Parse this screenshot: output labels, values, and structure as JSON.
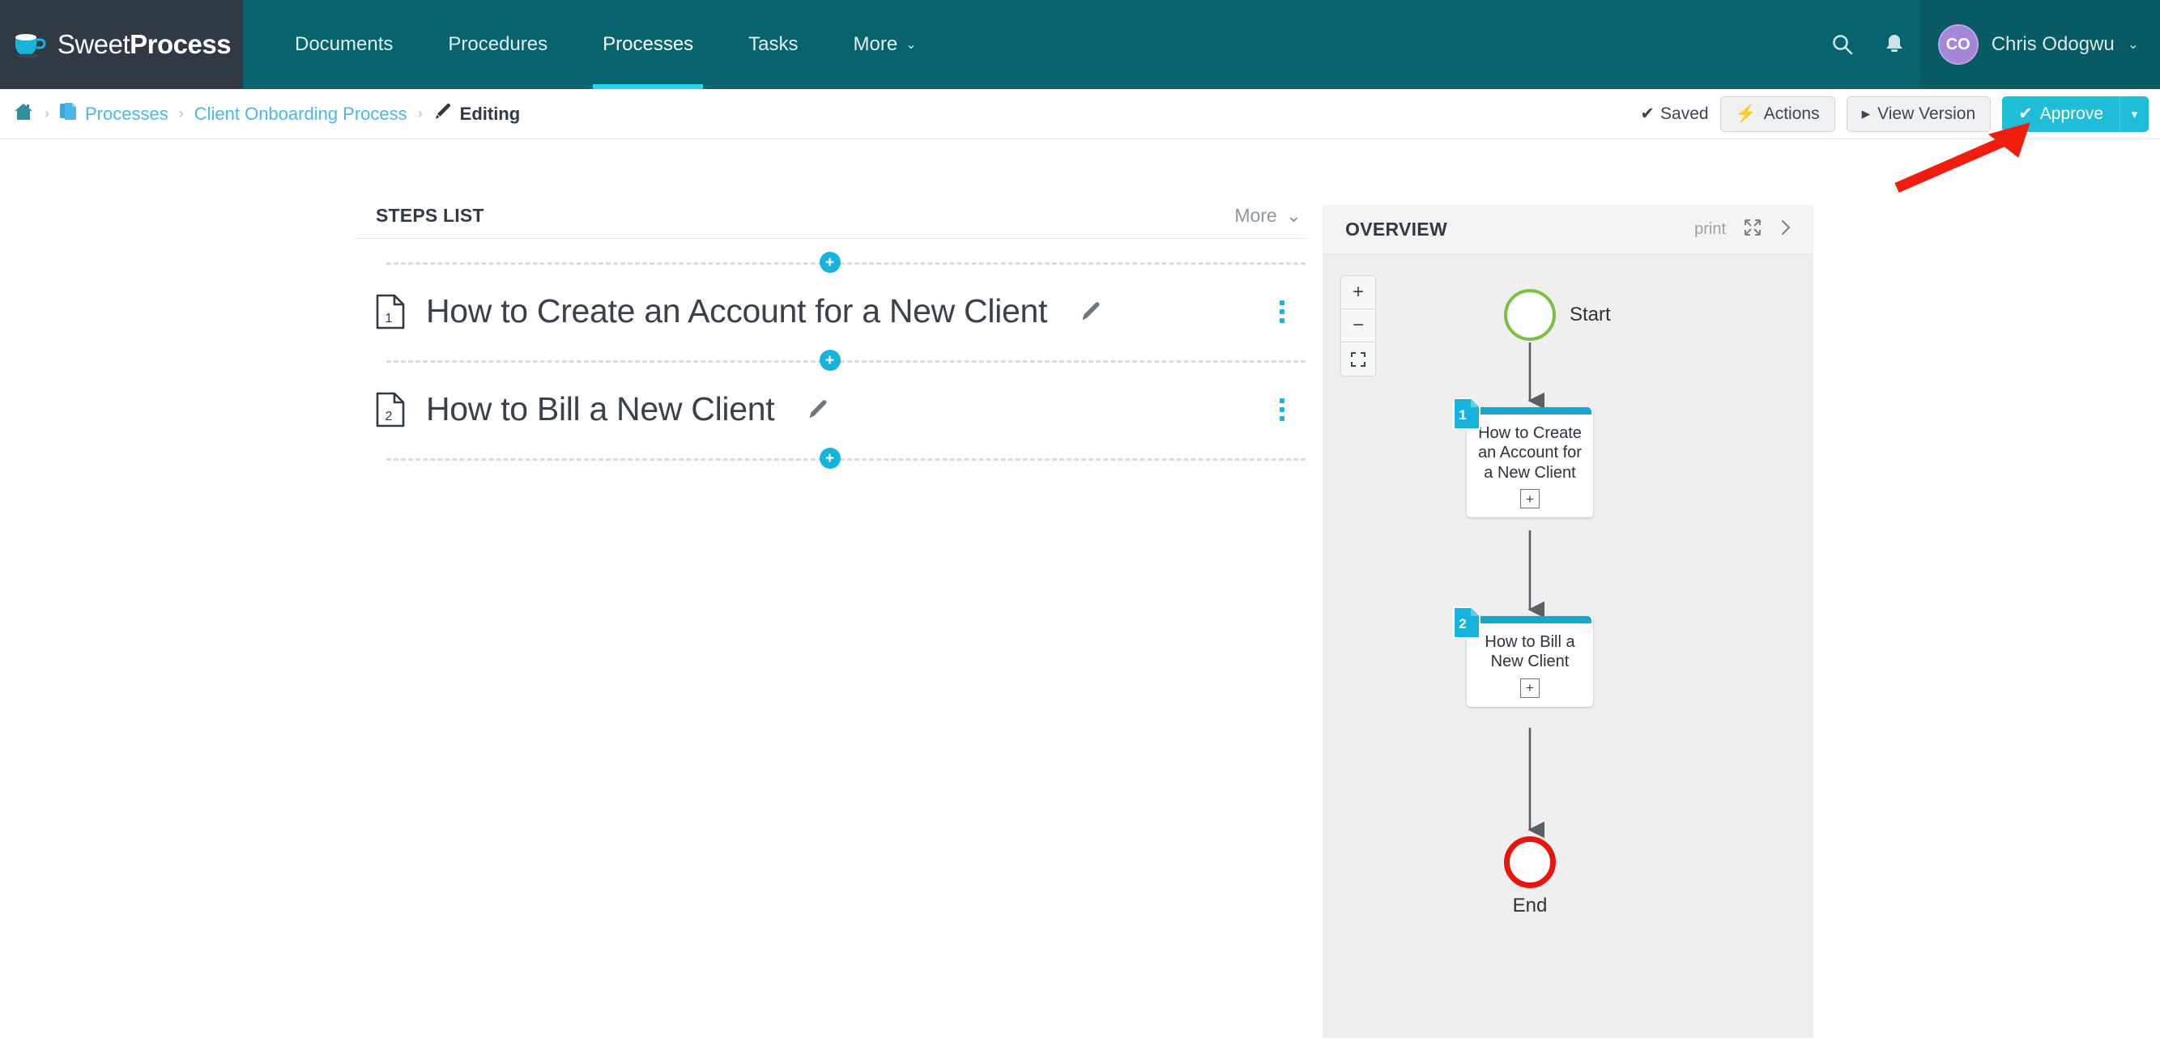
{
  "brand": {
    "name_thin": "Sweet",
    "name_bold": "Process",
    "logo_icon": "coffee-cup-icon",
    "accent_cyan": "#1fbdd8",
    "header_teal": "#07646e",
    "logo_bg": "#2f3a44"
  },
  "topnav": {
    "items": [
      {
        "label": "Documents",
        "active": false
      },
      {
        "label": "Procedures",
        "active": false
      },
      {
        "label": "Processes",
        "active": true
      },
      {
        "label": "Tasks",
        "active": false
      },
      {
        "label": "More",
        "active": false,
        "caret": "⌄"
      }
    ],
    "search_icon": "search-icon",
    "bell_icon": "bell-icon",
    "user": {
      "initials": "CO",
      "name": "Chris Odogwu",
      "caret": "⌄",
      "avatar_color": "#a586d8"
    }
  },
  "breadcrumb": {
    "home_icon": "home-icon",
    "separator": "›",
    "items": [
      {
        "label": "Processes",
        "icon": "documents-stack-icon",
        "type": "link"
      },
      {
        "label": "Client Onboarding Process",
        "icon": "",
        "type": "link"
      },
      {
        "label": "Editing",
        "icon": "pencil-icon",
        "type": "current"
      }
    ],
    "saved_label": "Saved",
    "saved_check": "✔",
    "actions": [
      {
        "label": "Actions",
        "icon": "⚡",
        "style": "default"
      },
      {
        "label": "View Version",
        "icon": "▸",
        "style": "default"
      }
    ],
    "approve": {
      "label": "Approve",
      "icon": "✔",
      "caret": "▾",
      "color": "#1fbdd8"
    }
  },
  "steps_panel": {
    "title": "STEPS LIST",
    "more_label": "More",
    "more_caret": "⌄",
    "add_step_glyph": "+",
    "steps": [
      {
        "number": "1",
        "title": "How to Create an Account for a New Client",
        "edit_icon": "pencil-icon",
        "menu_icon": "kebab-menu-icon"
      },
      {
        "number": "2",
        "title": "How to Bill a New Client",
        "edit_icon": "pencil-icon",
        "menu_icon": "kebab-menu-icon"
      }
    ]
  },
  "overview": {
    "title": "OVERVIEW",
    "print_label": "print",
    "fullscreen_icon": "expand-icon",
    "collapse_icon": "chevron-right-icon",
    "zoom_controls": {
      "in": "+",
      "out": "−",
      "fit": "fit-screen-icon"
    },
    "flow": {
      "start": {
        "label": "Start",
        "border_color": "#7ac143"
      },
      "end": {
        "label": "End",
        "border_color": "#e8150e"
      },
      "nodes": [
        {
          "number": "1",
          "label": "How to Create an Account for a New Client",
          "expand": "+",
          "bar_color": "#17a6cc"
        },
        {
          "number": "2",
          "label": "How to Bill a New Client",
          "expand": "+",
          "bar_color": "#17a6cc"
        }
      ]
    }
  },
  "annotation": {
    "type": "red-arrow",
    "color": "#f01c0e",
    "points_to": "Approve"
  }
}
